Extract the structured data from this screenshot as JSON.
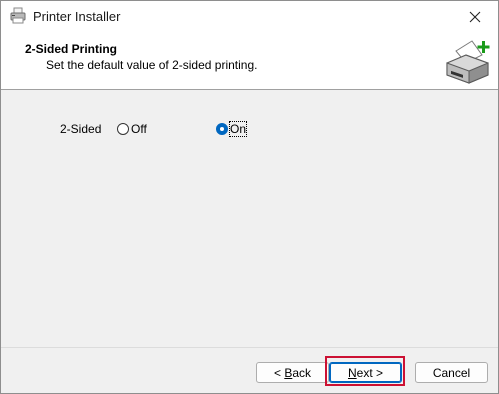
{
  "window": {
    "title": "Printer Installer",
    "close_icon": "close-icon",
    "app_icon": "printer-icon"
  },
  "header": {
    "title": "2-Sided Printing",
    "subtitle": "Set the default value of 2-sided printing.",
    "icon": "printer-add-icon"
  },
  "setting": {
    "label": "2-Sided",
    "options": [
      {
        "label": "Off",
        "selected": false
      },
      {
        "label": "On",
        "selected": true
      }
    ]
  },
  "buttons": {
    "back_prefix": "< ",
    "back_mnemonic": "B",
    "back_rest": "ack",
    "next_mnemonic": "N",
    "next_rest": "ext >",
    "cancel": "Cancel"
  },
  "colors": {
    "accent": "#0067c0",
    "highlight_box": "#cc1133"
  }
}
